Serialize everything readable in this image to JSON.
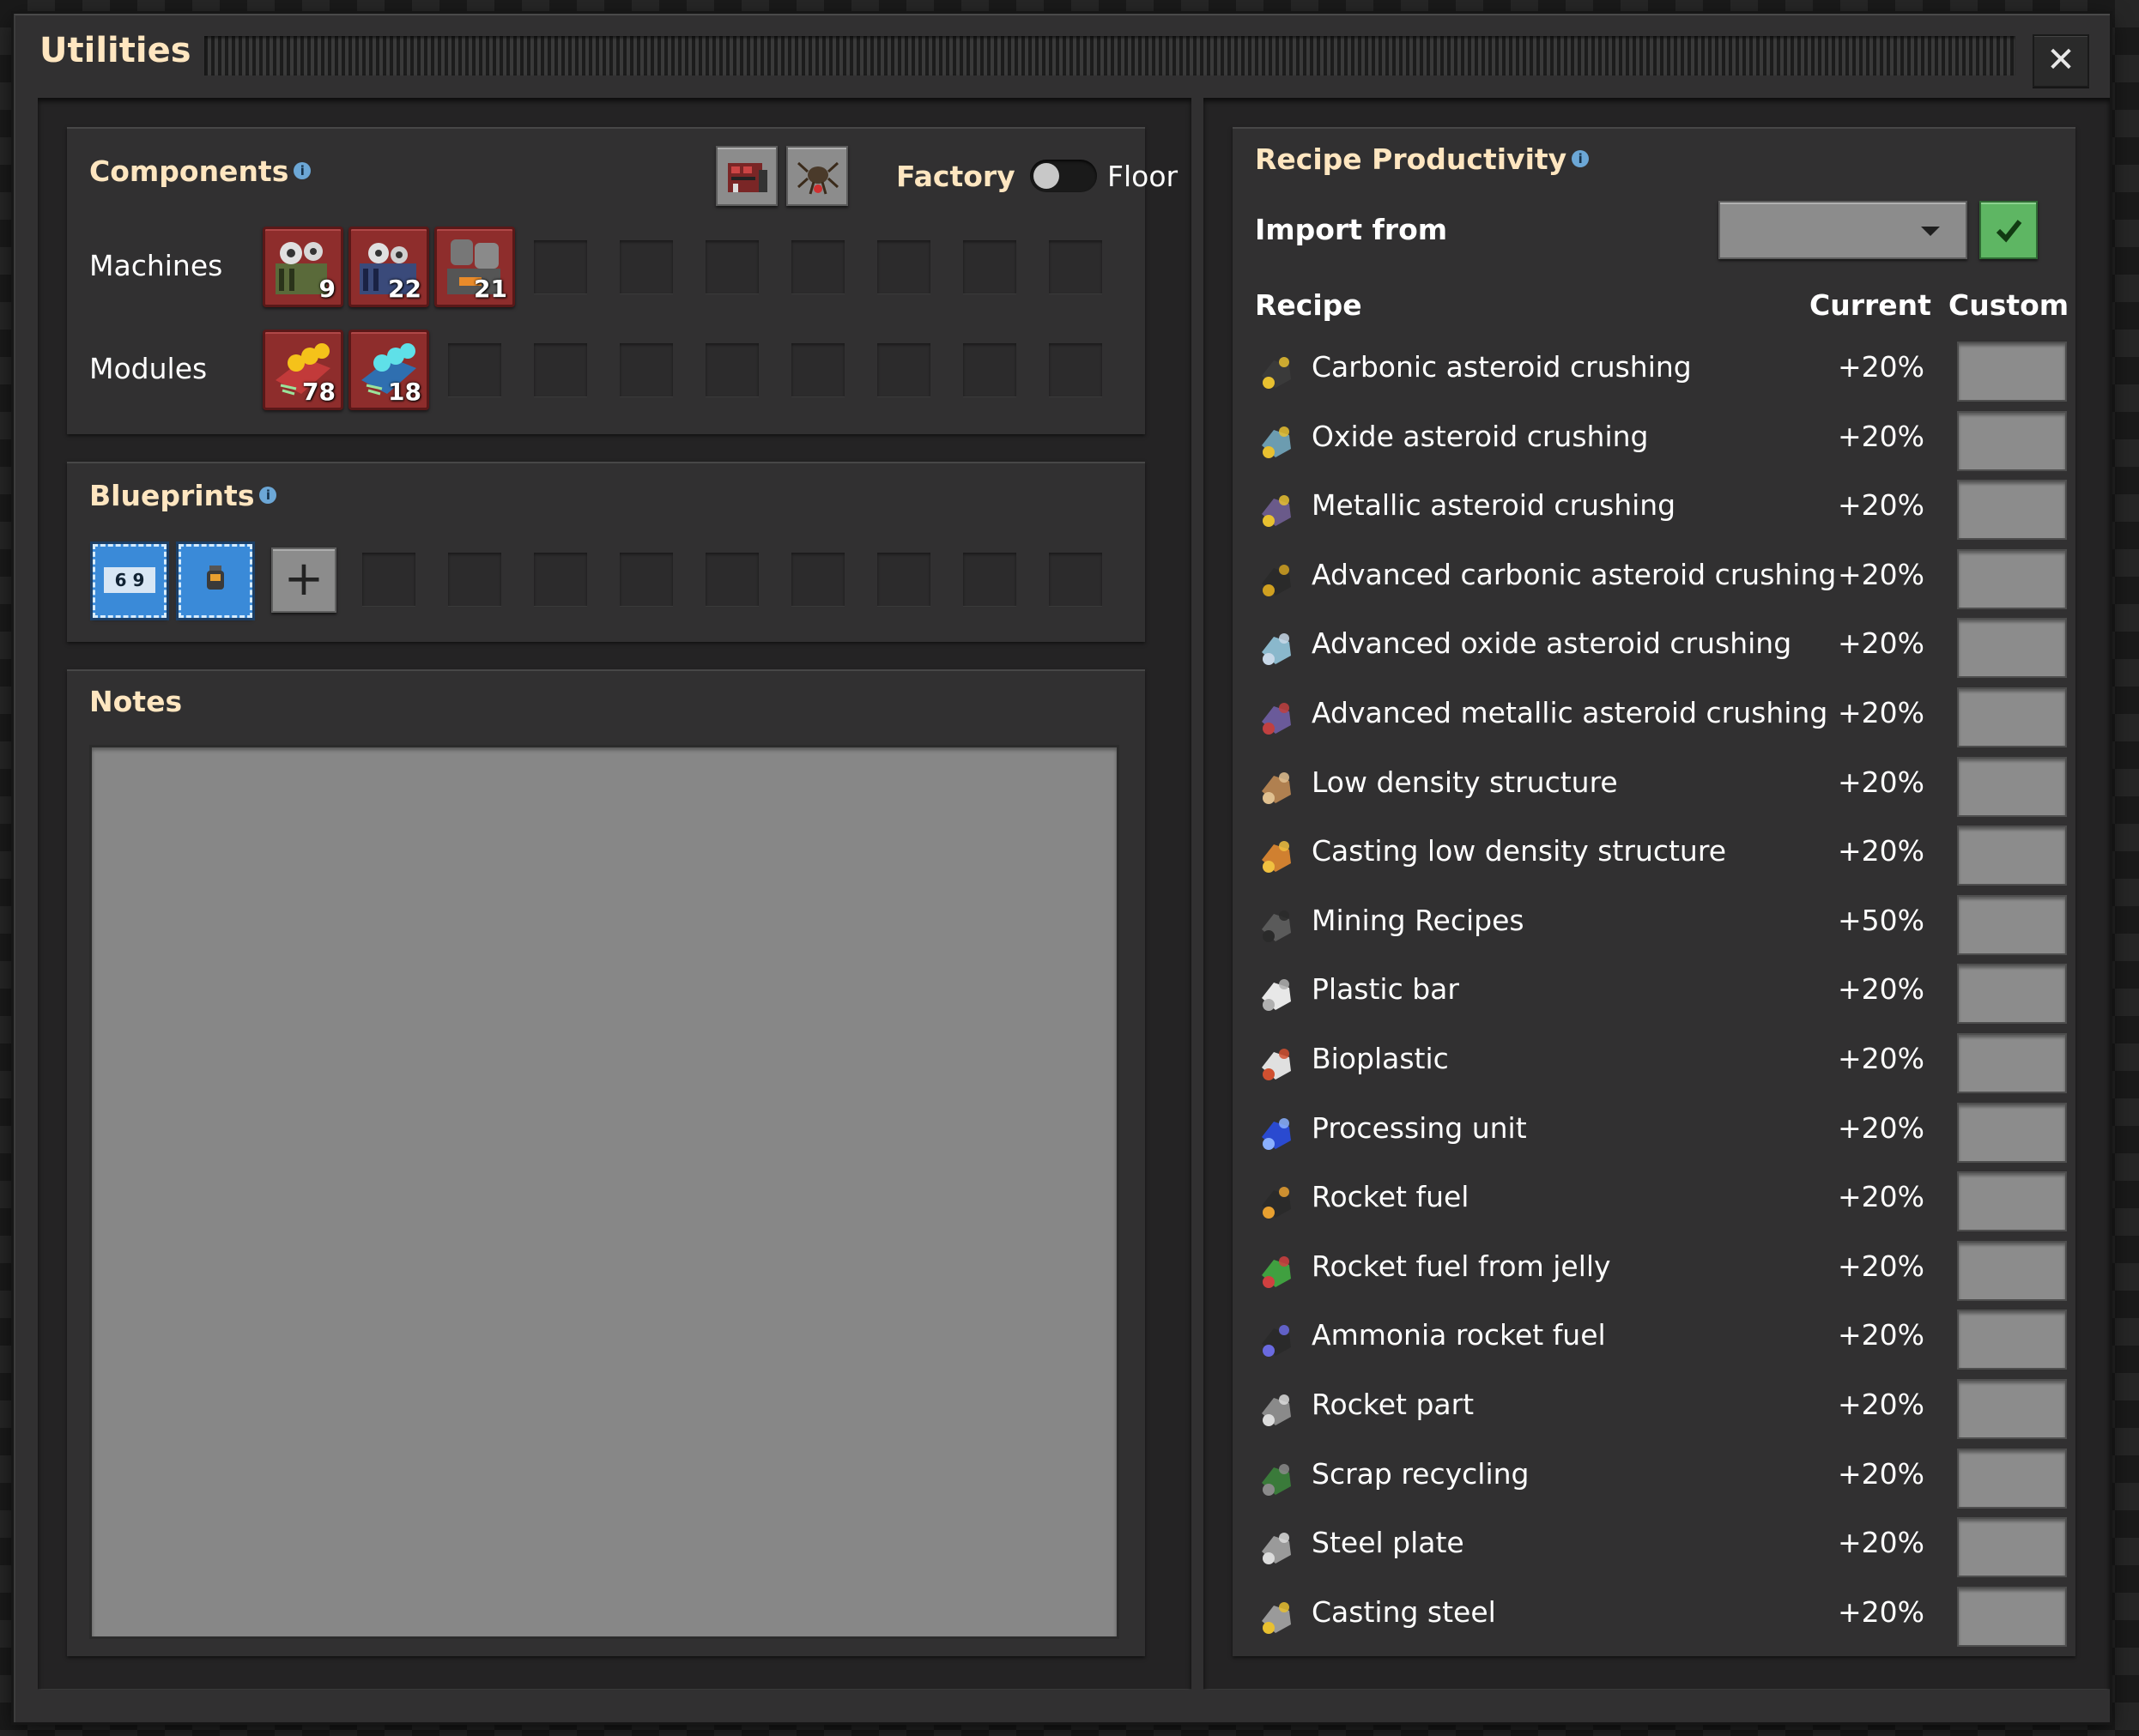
{
  "window": {
    "title": "Utilities",
    "close_label": "✕"
  },
  "components": {
    "title": "Components",
    "info": "i",
    "toggle": {
      "left_label": "Factory",
      "right_label": "Floor",
      "state": "Factory"
    },
    "machines_label": "Machines",
    "modules_label": "Modules",
    "machines": [
      {
        "icon": "assembling-machine-icon",
        "count": "9"
      },
      {
        "icon": "electromagnetic-plant-icon",
        "count": "22"
      },
      {
        "icon": "foundry-icon",
        "count": "21"
      }
    ],
    "modules": [
      {
        "icon": "productivity-module-icon",
        "count": "78"
      },
      {
        "icon": "speed-module-icon",
        "count": "18"
      }
    ],
    "tools": [
      {
        "icon": "factory-toggle-icon"
      },
      {
        "icon": "biter-icon"
      }
    ]
  },
  "blueprints": {
    "title": "Blueprints",
    "info": "i",
    "items": [
      {
        "icon": "blueprint-combinator-icon",
        "glyph": "6 9"
      },
      {
        "icon": "blueprint-robot-icon",
        "glyph": ""
      }
    ],
    "add_label": "+"
  },
  "notes": {
    "title": "Notes",
    "value": ""
  },
  "productivity": {
    "title": "Recipe Productivity",
    "info": "i",
    "import_label": "Import from",
    "import_value": "",
    "headers": {
      "recipe": "Recipe",
      "current": "Current",
      "custom": "Custom"
    },
    "recipes": [
      {
        "name": "Carbonic asteroid crushing",
        "current": "+20%",
        "custom": "",
        "icon": "carbonic-asteroid-icon"
      },
      {
        "name": "Oxide asteroid crushing",
        "current": "+20%",
        "custom": "",
        "icon": "oxide-asteroid-icon"
      },
      {
        "name": "Metallic asteroid crushing",
        "current": "+20%",
        "custom": "",
        "icon": "metallic-asteroid-icon"
      },
      {
        "name": "Advanced carbonic asteroid crushing",
        "current": "+20%",
        "custom": "",
        "icon": "advanced-carbonic-asteroid-icon"
      },
      {
        "name": "Advanced oxide asteroid crushing",
        "current": "+20%",
        "custom": "",
        "icon": "advanced-oxide-asteroid-icon"
      },
      {
        "name": "Advanced metallic asteroid crushing",
        "current": "+20%",
        "custom": "",
        "icon": "advanced-metallic-asteroid-icon"
      },
      {
        "name": "Low density structure",
        "current": "+20%",
        "custom": "",
        "icon": "low-density-structure-icon"
      },
      {
        "name": "Casting low density structure",
        "current": "+20%",
        "custom": "",
        "icon": "casting-low-density-structure-icon"
      },
      {
        "name": "Mining Recipes",
        "current": "+50%",
        "custom": "",
        "icon": "mining-drill-icon"
      },
      {
        "name": "Plastic bar",
        "current": "+20%",
        "custom": "",
        "icon": "plastic-bar-icon"
      },
      {
        "name": "Bioplastic",
        "current": "+20%",
        "custom": "",
        "icon": "bioplastic-icon"
      },
      {
        "name": "Processing unit",
        "current": "+20%",
        "custom": "",
        "icon": "processing-unit-icon"
      },
      {
        "name": "Rocket fuel",
        "current": "+20%",
        "custom": "",
        "icon": "rocket-fuel-icon"
      },
      {
        "name": "Rocket fuel from jelly",
        "current": "+20%",
        "custom": "",
        "icon": "rocket-fuel-jelly-icon"
      },
      {
        "name": "Ammonia rocket fuel",
        "current": "+20%",
        "custom": "",
        "icon": "ammonia-rocket-fuel-icon"
      },
      {
        "name": "Rocket part",
        "current": "+20%",
        "custom": "",
        "icon": "rocket-part-icon"
      },
      {
        "name": "Scrap recycling",
        "current": "+20%",
        "custom": "",
        "icon": "scrap-icon"
      },
      {
        "name": "Steel plate",
        "current": "+20%",
        "custom": "",
        "icon": "steel-plate-icon"
      },
      {
        "name": "Casting steel",
        "current": "+20%",
        "custom": "",
        "icon": "casting-steel-icon"
      }
    ]
  },
  "colors": {
    "heading": "#ffe6c0",
    "panel": "#313031",
    "inset": "#242324",
    "item_slot": "#8e2d2c",
    "confirm": "#5eb663",
    "blueprint": "#3a8ad8"
  }
}
